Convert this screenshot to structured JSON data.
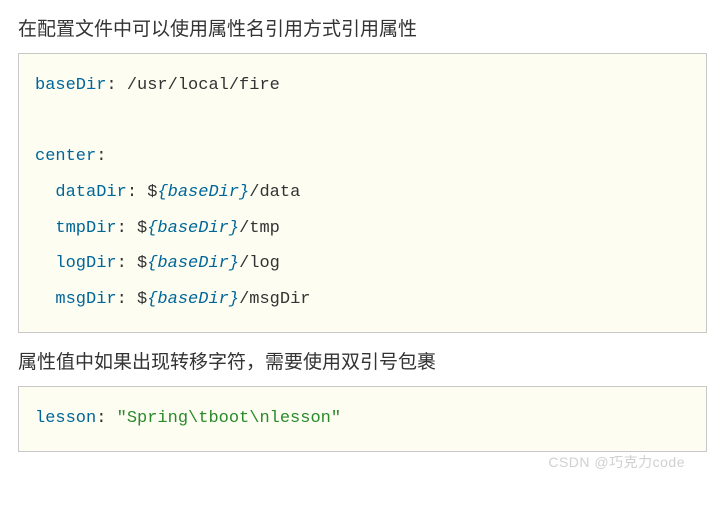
{
  "section1": {
    "desc": "在配置文件中可以使用属性名引用方式引用属性",
    "code": {
      "baseDir_key": "baseDir",
      "baseDir_val": " /usr/local/fire",
      "center_key": "center",
      "dataDir_key": "dataDir",
      "dataDir_pre": " $",
      "dataDir_bind": "{baseDir}",
      "dataDir_post": "/data",
      "tmpDir_key": "tmpDir",
      "tmpDir_pre": " $",
      "tmpDir_bind": "{baseDir}",
      "tmpDir_post": "/tmp",
      "logDir_key": "logDir",
      "logDir_pre": " $",
      "logDir_bind": "{baseDir}",
      "logDir_post": "/log",
      "msgDir_key": "msgDir",
      "msgDir_pre": " $",
      "msgDir_bind": "{baseDir}",
      "msgDir_post": "/msgDir"
    }
  },
  "section2": {
    "desc": "属性值中如果出现转移字符，需要使用双引号包裹",
    "code": {
      "lesson_key": "lesson",
      "lesson_sep": ": ",
      "lesson_str": "\"Spring\\tboot\\nlesson\""
    }
  },
  "watermark": "CSDN @巧克力code"
}
